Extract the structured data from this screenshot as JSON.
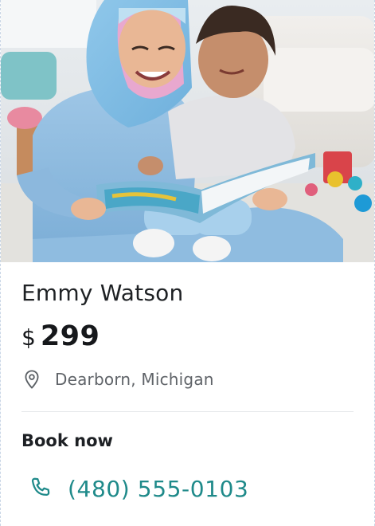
{
  "listing": {
    "name": "Emmy Watson",
    "price": {
      "currency": "$",
      "amount": "299"
    },
    "location": "Dearborn, Michigan",
    "book_label": "Book now",
    "phone": "(480) 555-0103"
  },
  "icons": {
    "location": "map-pin-icon",
    "phone": "phone-icon"
  },
  "colors": {
    "accent": "#1f8a8a",
    "text": "#1e2124",
    "muted": "#5f6368"
  }
}
